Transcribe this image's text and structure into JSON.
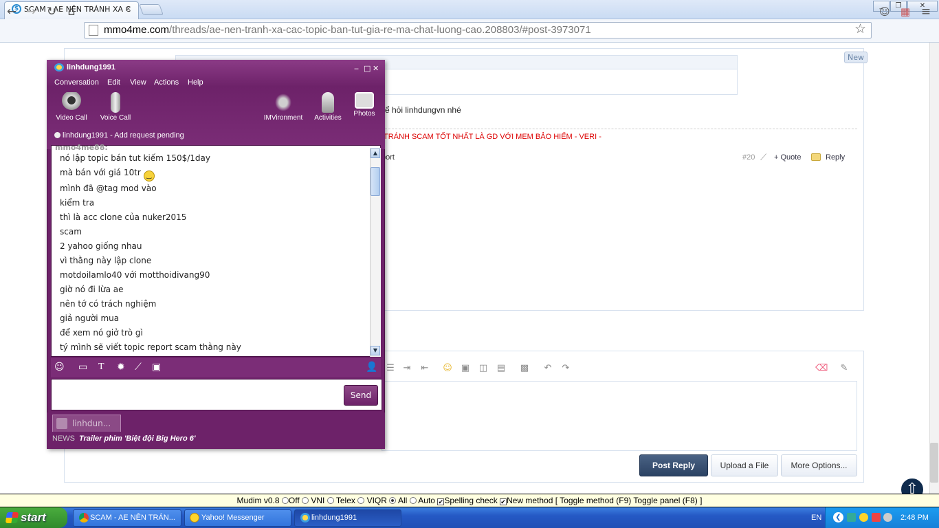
{
  "browser": {
    "tab_title": "SCAM - AE NÊN TRÁNH XA C",
    "tab_close": "×",
    "url_host": "mmo4me.com",
    "url_path": "/threads/ae-nen-tranh-xa-cac-topic-ban-tut-gia-re-ma-chat-luong-cao.208803/#post-3973071"
  },
  "forum": {
    "new_badge": "New",
    "post_text": "ể hỏi linhdungvn nhé",
    "signature": "TRÁNH SCAM TỐT NHẤT LÀ GD VỚI MEM BẢO HIỂM - VERI -",
    "report": "port",
    "post_number": "#20",
    "quote": "+ Quote",
    "reply": "Reply",
    "post_reply": "Post Reply",
    "upload": "Upload a File",
    "more_options": "More Options..."
  },
  "mudim": {
    "label": "Mudim v0.8",
    "opt_off": "Off",
    "opt_vni": "VNI",
    "opt_telex": "Telex",
    "opt_viqr": "VIQR",
    "opt_all": "All",
    "opt_auto": "Auto",
    "spelling": "Spelling check",
    "new_method": "New method",
    "toggles": "[ Toggle method (F9) Toggle panel (F8) ]"
  },
  "taskbar": {
    "start": "start",
    "task1": "SCAM - AE NÊN TRÁN...",
    "task2": "Yahoo! Messenger",
    "task3": "linhdung1991",
    "lang": "EN",
    "time": "2:48 PM"
  },
  "ym": {
    "title": "linhdung1991",
    "menu": [
      "Conversation",
      "Edit",
      "View",
      "Actions",
      "Help"
    ],
    "tools": {
      "video": "Video Call",
      "voice": "Voice Call",
      "imv": "IMVironment",
      "activities": "Activities",
      "photos": "Photos"
    },
    "status_name": "linhdung1991",
    "status_text": "-  Add request pending",
    "cutoff": "mmo4me88:",
    "messages": [
      "nó lập topic bán tut kiếm 150$/1day",
      "mà bán với giá 10tr",
      "mình đã @tag mod vào",
      "kiểm tra",
      "thì là acc clone của nuker2015",
      "scam",
      "2 yahoo giống nhau",
      "vì thằng này lập clone",
      "motdoilamlo40 với motthoidivang90",
      "giờ nó đi lừa ae",
      "nên tớ có trách nghiệm",
      "giả người mua",
      "để xem nó giở trò gì",
      "tý mình sẽ viết topic report scam thằng này"
    ],
    "send": "Send",
    "tab_label": "linhdun...",
    "news_label": "NEWS",
    "news_text": "Trailer phim 'Biệt đội Big Hero 6'"
  }
}
